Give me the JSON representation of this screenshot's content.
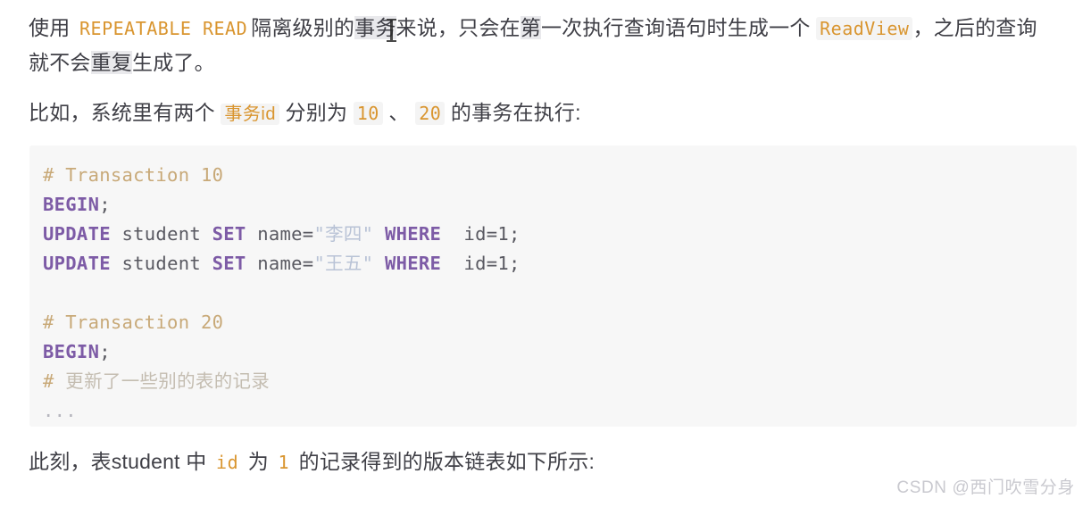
{
  "article": {
    "paragraph_intro": {
      "seg1": "使用 ",
      "code1": "REPEATABLE READ",
      "seg2": "隔离级别的",
      "hl1": "事务",
      "seg3": "来说，只会在",
      "hl2": "第",
      "seg4": "一次执行查询语句时生成一个 ",
      "code2": "ReadView",
      "seg5": "，之后的查询",
      "seg6": "就不会",
      "hl3": "重复",
      "seg7": "生成了。"
    },
    "paragraph_example": {
      "seg1": "比如，系统里有两个 ",
      "code1": "事务id",
      "seg2": " 分别为 ",
      "code2": "10",
      "seg3": " 、 ",
      "code3": "20",
      "seg4": " 的事务在执行:"
    },
    "paragraph_result": {
      "seg1": "此刻，表student 中 ",
      "code1": "id",
      "seg2": " 为 ",
      "code2": "1",
      "seg3": " 的记录得到的版本链表如下所示:"
    }
  },
  "code_block": {
    "language": "sql",
    "lines": [
      {
        "id": "line-comment-tx10",
        "tokens": [
          {
            "t": "comment",
            "v": "# Transaction 10"
          }
        ]
      },
      {
        "id": "line-begin-1",
        "tokens": [
          {
            "t": "kw",
            "v": "BEGIN"
          },
          {
            "t": "punct",
            "v": ";"
          }
        ]
      },
      {
        "id": "line-update-lisi",
        "tokens": [
          {
            "t": "kw",
            "v": "UPDATE"
          },
          {
            "t": "plain",
            "v": " student "
          },
          {
            "t": "kw",
            "v": "SET"
          },
          {
            "t": "plain",
            "v": " name="
          },
          {
            "t": "str",
            "v": "\"李四\""
          },
          {
            "t": "plain",
            "v": " "
          },
          {
            "t": "kw",
            "v": "WHERE"
          },
          {
            "t": "plain",
            "v": "  id=1;"
          }
        ]
      },
      {
        "id": "line-update-wangwu",
        "tokens": [
          {
            "t": "kw",
            "v": "UPDATE"
          },
          {
            "t": "plain",
            "v": " student "
          },
          {
            "t": "kw",
            "v": "SET"
          },
          {
            "t": "plain",
            "v": " name="
          },
          {
            "t": "str",
            "v": "\"王五\""
          },
          {
            "t": "plain",
            "v": " "
          },
          {
            "t": "kw",
            "v": "WHERE"
          },
          {
            "t": "plain",
            "v": "  id=1;"
          }
        ]
      },
      {
        "id": "line-blank-1",
        "tokens": [
          {
            "t": "plain",
            "v": " "
          }
        ]
      },
      {
        "id": "line-comment-tx20",
        "tokens": [
          {
            "t": "comment",
            "v": "# Transaction 20"
          }
        ]
      },
      {
        "id": "line-begin-2",
        "tokens": [
          {
            "t": "kw",
            "v": "BEGIN"
          },
          {
            "t": "punct",
            "v": ";"
          }
        ]
      },
      {
        "id": "line-comment-cjk",
        "tokens": [
          {
            "t": "comment",
            "v": "# "
          },
          {
            "t": "comment-cjk",
            "v": "更新了一些别的表的记录"
          }
        ]
      },
      {
        "id": "line-ellipsis",
        "tokens": [
          {
            "t": "dots",
            "v": "..."
          }
        ]
      }
    ]
  },
  "watermark": {
    "text": "CSDN @西门吹雪分身"
  },
  "colors": {
    "text": "#3f3f46",
    "inline_code": "#d9952f",
    "inline_code_bg": "#f4f4f4",
    "highlight_bg": "#e9e9ec",
    "code_block_bg": "#f7f7f7",
    "keyword": "#7d5ba6",
    "comment": "#c8a978",
    "comment_cjk": "#c4bdb1",
    "string": "#b9c3d6",
    "code_plain": "#595961",
    "watermark": "#c9c9cf",
    "page_bg": "#ffffff"
  }
}
